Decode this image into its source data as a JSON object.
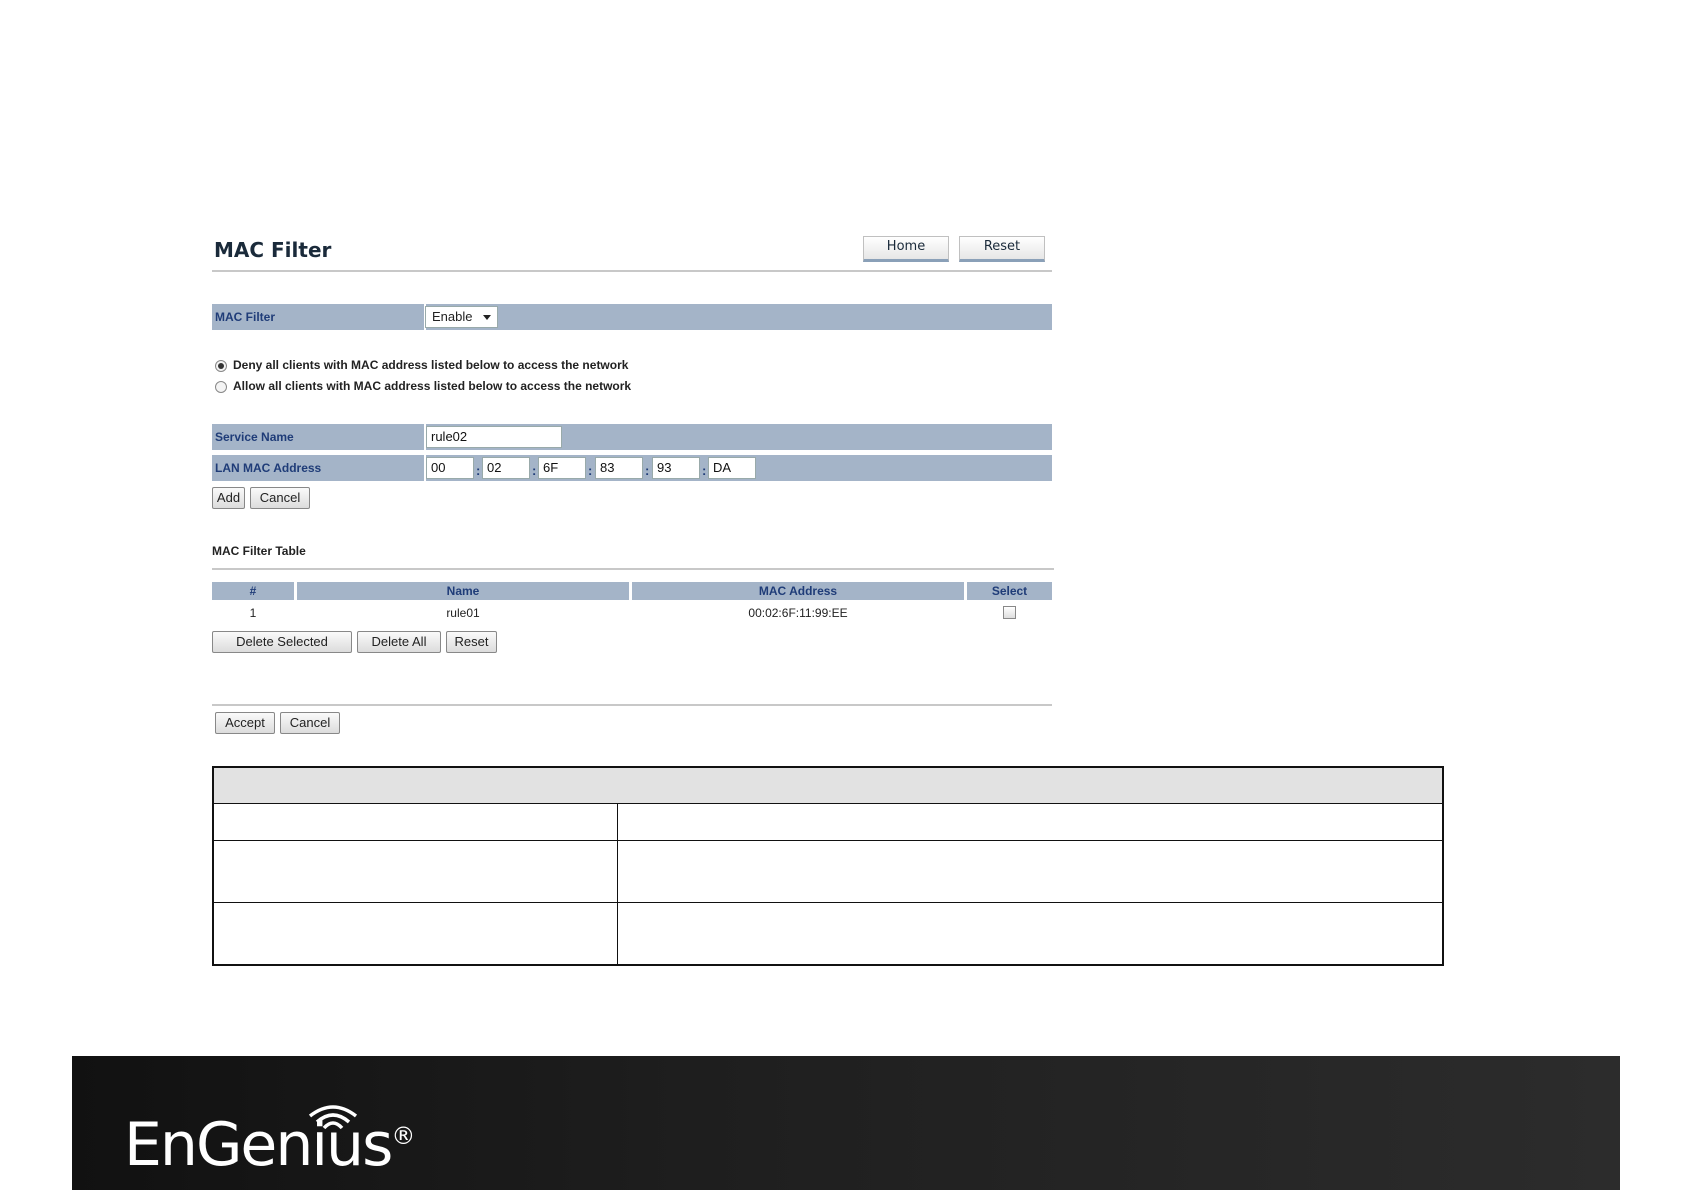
{
  "header": {
    "title": "MAC Filter",
    "home_label": "Home",
    "reset_label": "Reset"
  },
  "mac_filter": {
    "label": "MAC Filter",
    "value": "Enable"
  },
  "policy": {
    "options": [
      {
        "label": "Deny all clients with MAC address listed below to access the network",
        "selected": true
      },
      {
        "label": "Allow all clients with MAC address listed below to access the network",
        "selected": false
      }
    ]
  },
  "service": {
    "label": "Service Name",
    "value": "rule02"
  },
  "lan_mac": {
    "label": "LAN MAC Address",
    "octets": [
      "00",
      "02",
      "6F",
      "83",
      "93",
      "DA"
    ],
    "separator": ":"
  },
  "form_buttons": {
    "add": "Add",
    "cancel": "Cancel"
  },
  "filter_table": {
    "title": "MAC Filter Table",
    "columns": [
      "#",
      "Name",
      "MAC Address",
      "Select"
    ],
    "rows": [
      {
        "num": "1",
        "name": "rule01",
        "mac": "00:02:6F:11:99:EE",
        "selected": false
      }
    ],
    "buttons": {
      "delete_selected": "Delete Selected",
      "delete_all": "Delete All",
      "reset": "Reset"
    }
  },
  "bottom_buttons": {
    "accept": "Accept",
    "cancel": "Cancel"
  },
  "footer": {
    "brand": "EnGenius",
    "registered": "®"
  }
}
